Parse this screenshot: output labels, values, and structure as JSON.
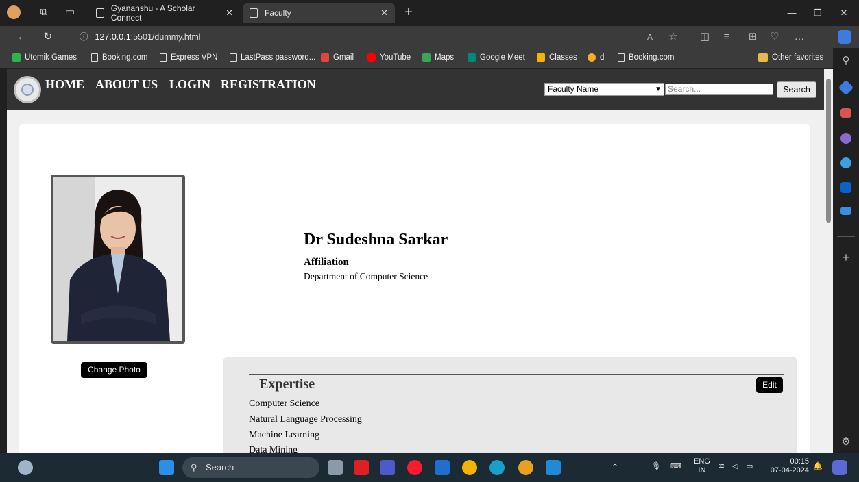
{
  "browser": {
    "tabs": [
      {
        "label": "Gyananshu - A Scholar Connect"
      },
      {
        "label": "Faculty"
      }
    ],
    "url_host": "127.0.0.1",
    "url_rest": ":5501/dummy.html",
    "bookmarks": [
      "Utomik Games",
      "Booking.com",
      "Express VPN",
      "LastPass password...",
      "Gmail",
      "YouTube",
      "Maps",
      "Google Meet",
      "Classes",
      "d",
      "Booking.com"
    ],
    "other_favorites": "Other favorites"
  },
  "navbar": {
    "links": [
      "HOME",
      "ABOUT US",
      "LOGIN",
      "REGISTRATION"
    ],
    "select_value": "Faculty Name",
    "search_placeholder": "Search...",
    "search_button": "Search"
  },
  "profile": {
    "name": "Dr Sudeshna Sarkar",
    "affiliation_label": "Affiliation",
    "affiliation_value": "Department of Computer Science",
    "change_photo": "Change Photo"
  },
  "expertise": {
    "title": "Expertise",
    "edit_label": "Edit",
    "items": [
      "Computer Science",
      "Natural Language Processing",
      "Machine Learning",
      "Data Mining"
    ]
  },
  "taskbar": {
    "search_label": "Search",
    "lang_top": "ENG",
    "lang_bottom": "IN",
    "time": "00:15",
    "date": "07-04-2024"
  }
}
